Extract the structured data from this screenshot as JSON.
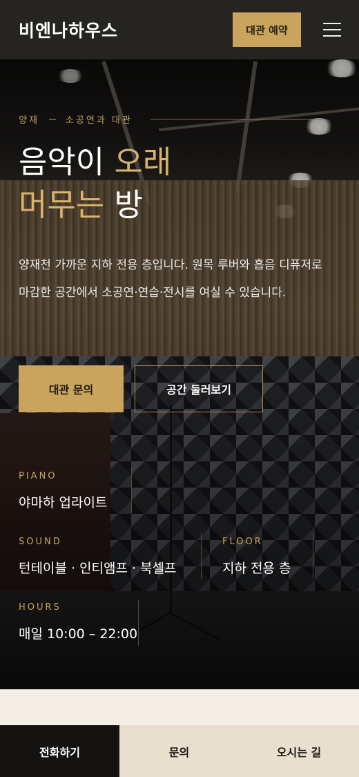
{
  "header": {
    "brand": "비엔나하우스",
    "reserve_label": "대관 예약",
    "menu_icon": "hamburger-menu-icon"
  },
  "hero": {
    "eyebrow_left": "양재",
    "eyebrow_right": "소공연과 대관",
    "title_line1_white": "음악이 ",
    "title_line1_gold": "오래",
    "title_line2_gold": "머무는 ",
    "title_line2_white": "방",
    "description": "양재천 가까운 지하 전용 층입니다. 원목 루버와 흡음 디퓨저로 마감한 공간에서 소공연·연습·전시를 여실 수 있습니다.",
    "primary_cta": "대관 문의",
    "secondary_cta": "공간 둘러보기"
  },
  "specs": {
    "piano_label": "PIANO",
    "piano_value": "야마하 업라이트",
    "sound_label": "SOUND",
    "sound_value": "턴테이블 · 인티앰프 · 북셀프",
    "floor_label": "FLOOR",
    "floor_value": "지하 전용 층",
    "hours_label": "HOURS",
    "hours_value": "매일 10:00 – 22:00"
  },
  "bottom_bar": {
    "call": "전화하기",
    "inquiry": "문의",
    "directions": "오시는 길"
  },
  "colors": {
    "accent_gold": "#c9a45c",
    "header_bg": "#262421",
    "bottom_active": "#141312",
    "bottom_inactive": "#e8dfcf"
  }
}
